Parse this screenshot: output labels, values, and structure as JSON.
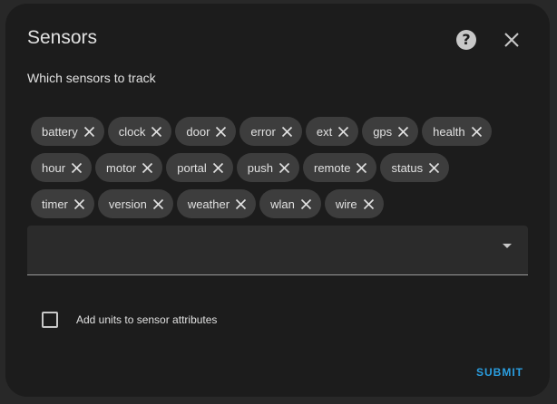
{
  "dialog": {
    "title": "Sensors",
    "subtitle": "Which sensors to track",
    "help_icon_glyph": "?",
    "help_icon": "help-circle-icon",
    "close_icon": "close-icon"
  },
  "chips": {
    "rows": [
      [
        "battery",
        "clock",
        "door",
        "error",
        "ext",
        "gps",
        "health"
      ],
      [
        "hour",
        "motor",
        "portal",
        "push",
        "remote",
        "status"
      ],
      [
        "timer",
        "version",
        "weather",
        "wlan",
        "wire"
      ]
    ],
    "remove_icon": "close-icon"
  },
  "select": {
    "value": "",
    "arrow_icon": "dropdown-arrow-icon"
  },
  "options": {
    "units_label": "Add units to sensor attributes",
    "units_checked": false
  },
  "actions": {
    "submit_label": "SUBMIT"
  },
  "colors": {
    "accent": "#2a9ee0",
    "surface": "#1c1c1c",
    "chip": "#3d3d3d",
    "text": "#e1e1e1"
  }
}
